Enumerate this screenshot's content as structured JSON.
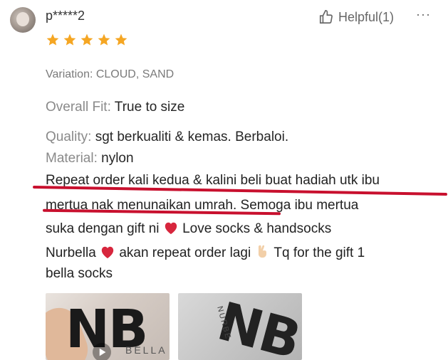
{
  "review": {
    "username": "p*****2",
    "helpful_label": "Helpful(1)",
    "more_label": "···",
    "rating": 5,
    "variation": "Variation: CLOUD, SAND",
    "fit_label": "Overall Fit:",
    "fit_value": "True to size",
    "quality_label": "Quality:",
    "quality_value": "sgt berkualiti & kemas. Berbaloi.",
    "material_label": "Material:",
    "material_value": "nylon",
    "body_lines": [
      "Repeat order kali kedua & kalini beli buat hadiah utk ibu",
      "mertua nak menunaikan umrah. Semoga ibu mertua",
      "suka dengan gift ni",
      "Love socks & handsocks",
      "Nurbella",
      "akan repeat order lagi",
      "Tq for the gift 1",
      "bella socks"
    ],
    "photos": [
      {
        "logo": "NB",
        "sub": "BELLA"
      },
      {
        "logo": "NB",
        "sub": "NURBE"
      }
    ]
  },
  "colors": {
    "star": "#f5a623",
    "underline": "#c8102e",
    "heart": "#d7263d"
  },
  "icons": [
    "thumbs-up-icon",
    "star-icon",
    "heart-icon",
    "crossed-fingers-icon",
    "play-icon"
  ]
}
